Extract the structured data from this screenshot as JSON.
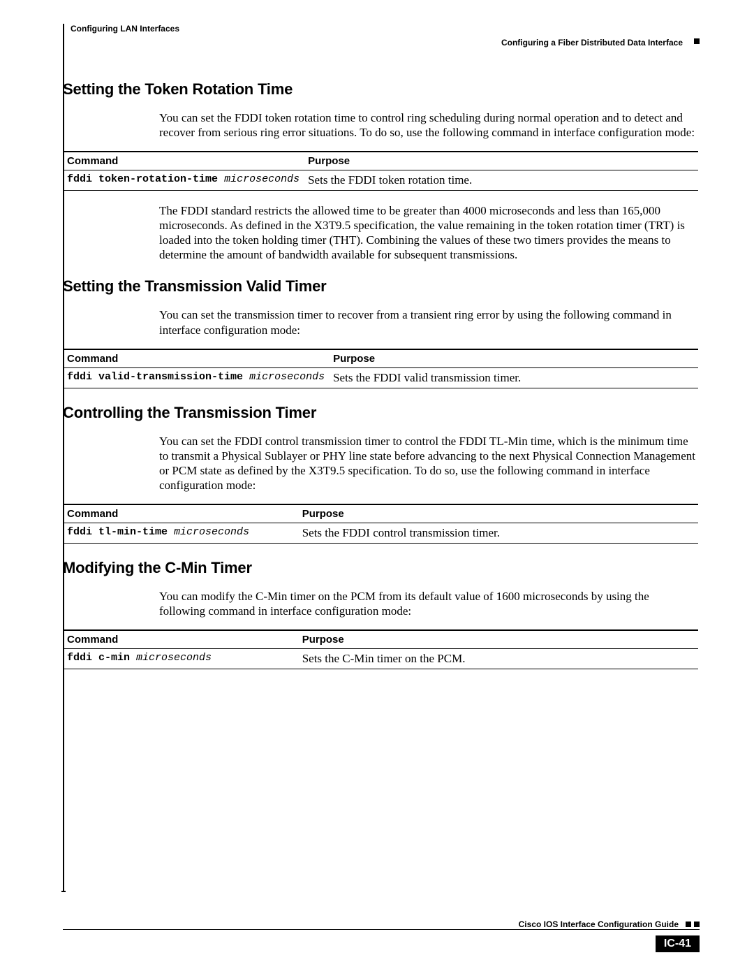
{
  "header": {
    "chapter": "Configuring LAN Interfaces",
    "section": "Configuring a Fiber Distributed Data Interface"
  },
  "table_headers": {
    "command": "Command",
    "purpose": "Purpose"
  },
  "sections": [
    {
      "title": "Setting the Token Rotation Time",
      "intro": "You can set the FDDI token rotation time to control ring scheduling during normal operation and to detect and recover from serious ring error situations. To do so, use the following command in interface configuration mode:",
      "command_bold": "fddi token-rotation-time",
      "command_arg": "microseconds",
      "purpose": "Sets the FDDI token rotation time.",
      "after": "The FDDI standard restricts the allowed time to be greater than 4000 microseconds and less than 165,000 microseconds. As defined in the X3T9.5 specification, the value remaining in the token rotation timer (TRT) is loaded into the token holding timer (THT). Combining the values of these two timers provides the means to determine the amount of bandwidth available for subsequent transmissions."
    },
    {
      "title": "Setting the Transmission Valid Timer",
      "intro": "You can set the transmission timer to recover from a transient ring error by using the following command in interface configuration mode:",
      "command_bold": "fddi valid-transmission-time",
      "command_arg": "microseconds",
      "purpose": "Sets the FDDI valid transmission timer."
    },
    {
      "title": "Controlling the Transmission Timer",
      "intro": "You can set the FDDI control transmission timer to control the FDDI TL-Min time, which is the minimum time to transmit a Physical Sublayer or PHY line state before advancing to the next Physical Connection Management or PCM state as defined by the X3T9.5 specification. To do so, use the following command in interface configuration mode:",
      "command_bold": "fddi tl-min-time",
      "command_arg": "microseconds",
      "purpose": "Sets the FDDI control transmission timer."
    },
    {
      "title": "Modifying the C-Min Timer",
      "intro": "You can modify the C-Min timer on the PCM from its default value of 1600 microseconds by using the following command in interface configuration mode:",
      "command_bold": "fddi c-min",
      "command_arg": "microseconds",
      "purpose": "Sets the C-Min timer on the PCM."
    }
  ],
  "footer": {
    "guide": "Cisco IOS Interface Configuration Guide",
    "page": "IC-41"
  }
}
